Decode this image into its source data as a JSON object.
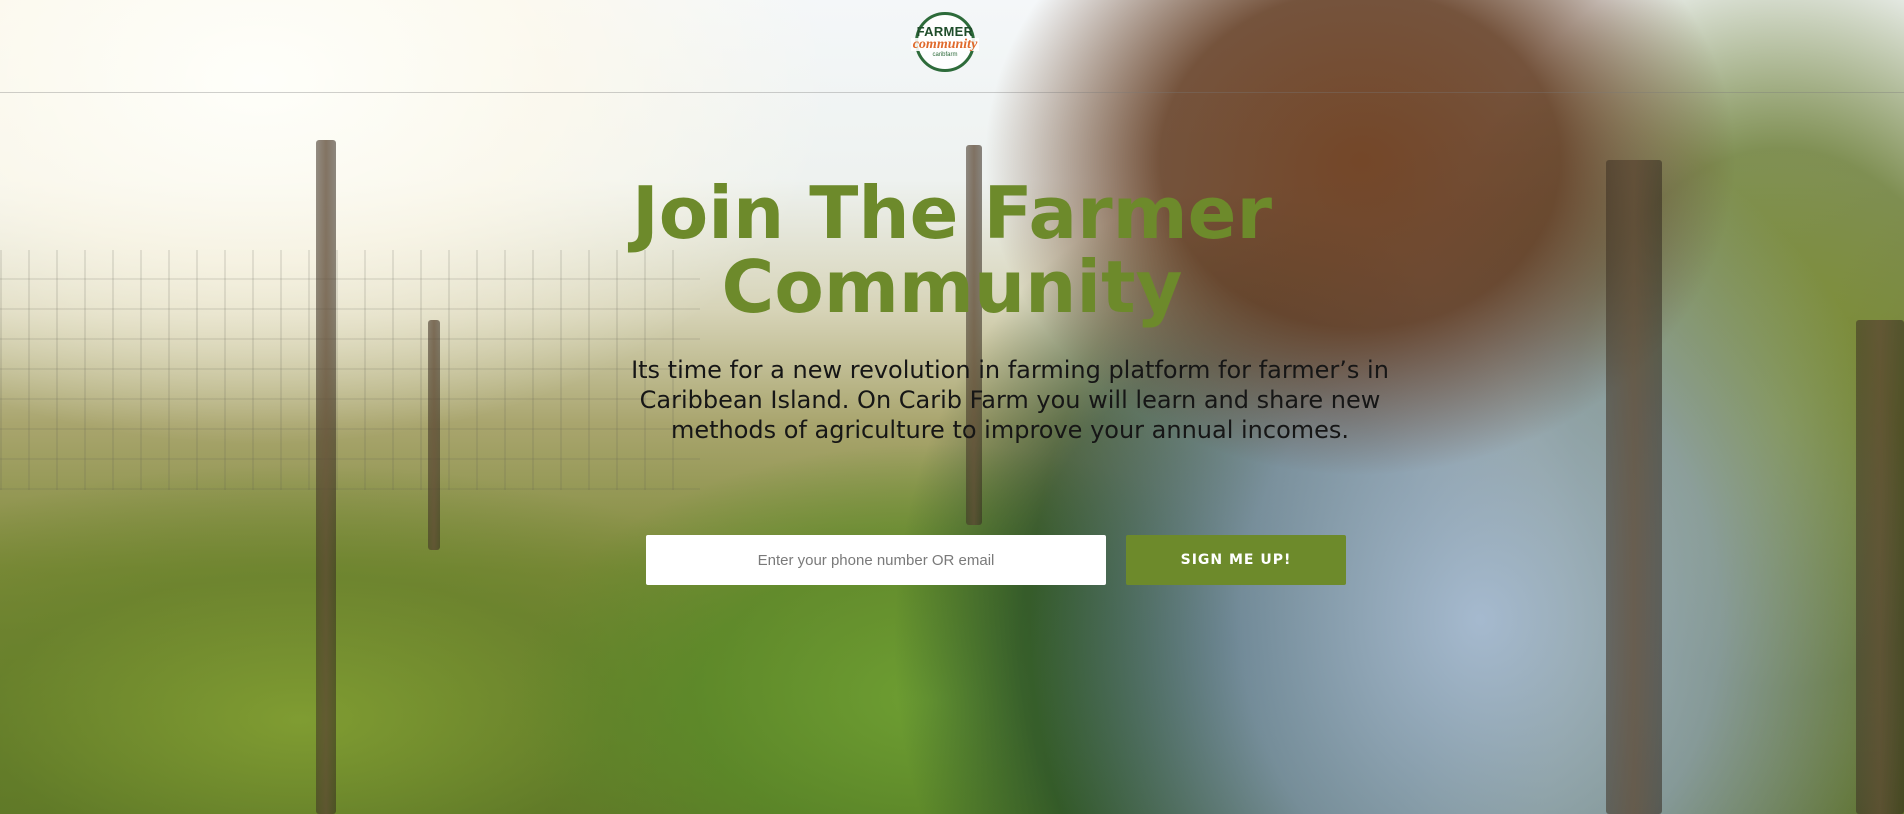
{
  "brand": {
    "logo_top": "FARMER",
    "logo_middle": "community",
    "logo_bottom": "caribfarm",
    "accent_color": "#6d8a2b",
    "logo_green": "#2d6b3a",
    "logo_orange": "#e06a2c"
  },
  "hero": {
    "headline": "Join The Farmer Community",
    "description": "Its time for a new revolution in farming platform for farmer’s in Caribbean Island. On Carib Farm you will learn and share new methods of agriculture to improve your annual incomes.",
    "background_image": "woman-farmer-harvesting-vegetables-photo"
  },
  "signup": {
    "input_placeholder": "Enter your phone number OR email",
    "input_value": "",
    "button_label": "SIGN ME UP!"
  }
}
